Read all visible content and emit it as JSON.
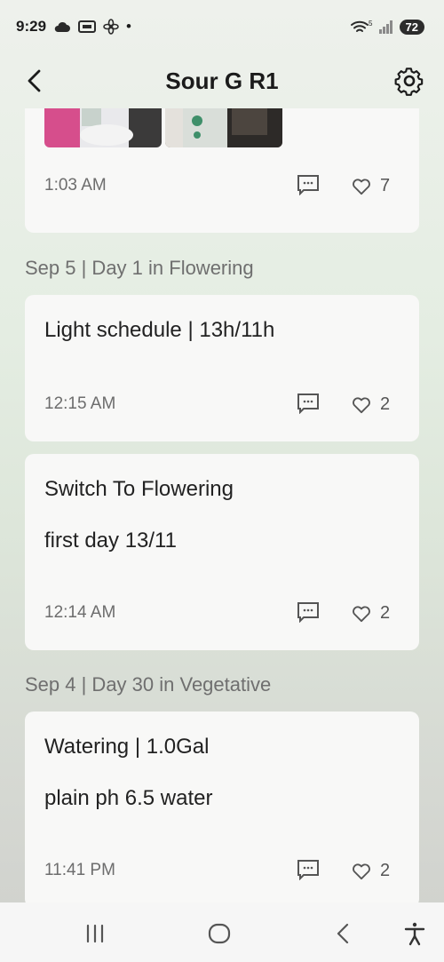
{
  "status_bar": {
    "time": "9:29",
    "battery": "72",
    "dot": "•",
    "signal_label": "5"
  },
  "header": {
    "title": "Sour G R1"
  },
  "entries": [
    {
      "time": "1:03 AM",
      "likes": "7"
    },
    {
      "text": "Light schedule | 13h/11h",
      "time": "12:15 AM",
      "likes": "2"
    },
    {
      "text": "Switch To Flowering",
      "text2": "first day 13/11",
      "time": "12:14 AM",
      "likes": "2"
    },
    {
      "text": "Watering | 1.0Gal",
      "text2": "plain ph 6.5 water",
      "time": "11:41 PM",
      "likes": "2"
    }
  ],
  "days": [
    {
      "label": "Sep 5 | Day 1 in Flowering"
    },
    {
      "label": "Sep 4 | Day 30 in Vegetative"
    }
  ],
  "icons": {
    "back": "chevron-left-icon",
    "settings": "gear-icon",
    "comment": "comment-icon",
    "like": "heart-icon"
  }
}
